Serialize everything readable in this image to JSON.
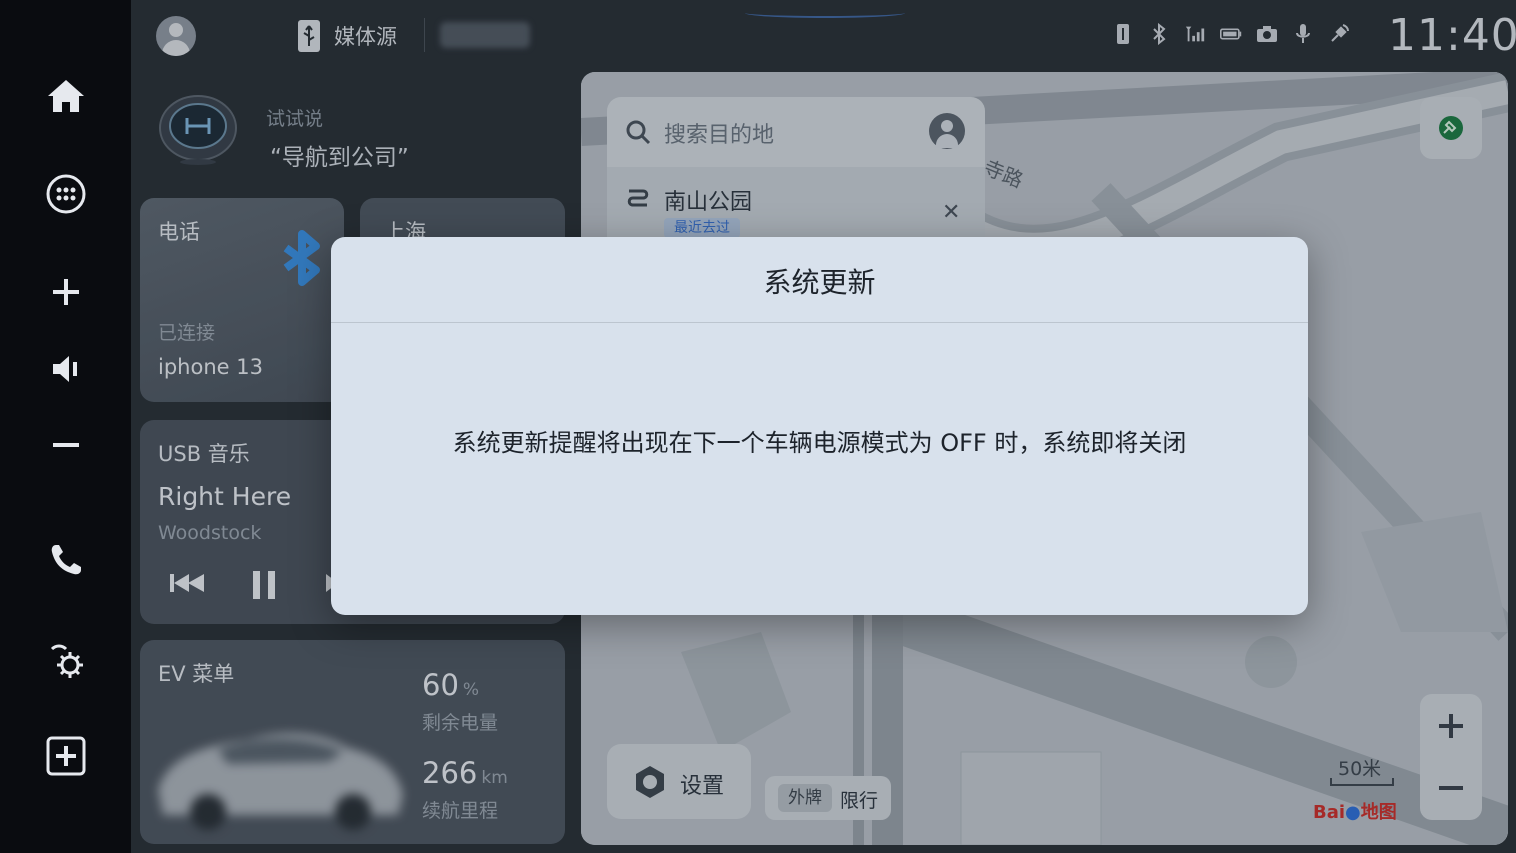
{
  "rail": {
    "items": [
      "home",
      "apps",
      "volume-up",
      "volume",
      "volume-down",
      "phone",
      "settings",
      "add"
    ]
  },
  "status_bar": {
    "media_source_label": "媒体源",
    "time": "11:40",
    "icons": [
      "usb-icon",
      "bluetooth-icon",
      "signal-icon",
      "battery-icon",
      "camera-icon",
      "mic-icon",
      "satellite-icon"
    ]
  },
  "voice": {
    "try_label": "试试说",
    "command": "“导航到公司”"
  },
  "phone_card": {
    "title": "电话",
    "status": "已连接",
    "device": "iphone 13"
  },
  "weather_card": {
    "title": "上海"
  },
  "music_card": {
    "title": "USB 音乐",
    "song": "Right Here",
    "artist": "Woodstock"
  },
  "ev_card": {
    "title": "EV 菜单",
    "battery_value": "60",
    "battery_unit": "%",
    "battery_label": "剩余电量",
    "range_value": "266",
    "range_unit": "km",
    "range_label": "续航里程"
  },
  "map": {
    "search_placeholder": "搜索目的地",
    "recent_name": "南山公园",
    "recent_tag": "最近去过",
    "road_label": "寺路",
    "settings_label": "设置",
    "limit_tag": "外牌",
    "limit_label": "限行",
    "scale": "50米",
    "logo_text": "Bai",
    "logo_suffix": "地图"
  },
  "dialog": {
    "title": "系统更新",
    "message": "系统更新提醒将出现在下一个车辆电源模式为 OFF 时，系统即将关闭"
  },
  "colors": {
    "dialog_bg": "#d8e1ec",
    "rail_bg": "#0a0c10",
    "accent_blue": "#3a73d1"
  }
}
